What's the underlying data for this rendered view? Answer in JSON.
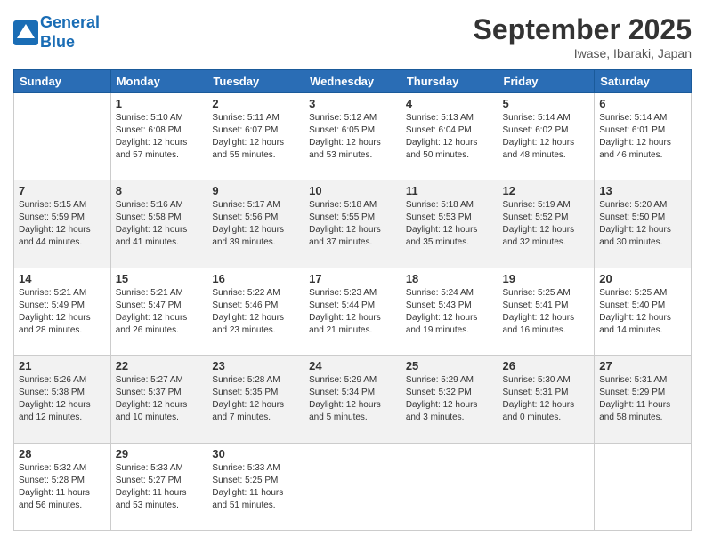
{
  "header": {
    "logo_line1": "General",
    "logo_line2": "Blue",
    "month": "September 2025",
    "location": "Iwase, Ibaraki, Japan"
  },
  "days_of_week": [
    "Sunday",
    "Monday",
    "Tuesday",
    "Wednesday",
    "Thursday",
    "Friday",
    "Saturday"
  ],
  "weeks": [
    [
      {
        "day": "",
        "info": ""
      },
      {
        "day": "1",
        "info": "Sunrise: 5:10 AM\nSunset: 6:08 PM\nDaylight: 12 hours\nand 57 minutes."
      },
      {
        "day": "2",
        "info": "Sunrise: 5:11 AM\nSunset: 6:07 PM\nDaylight: 12 hours\nand 55 minutes."
      },
      {
        "day": "3",
        "info": "Sunrise: 5:12 AM\nSunset: 6:05 PM\nDaylight: 12 hours\nand 53 minutes."
      },
      {
        "day": "4",
        "info": "Sunrise: 5:13 AM\nSunset: 6:04 PM\nDaylight: 12 hours\nand 50 minutes."
      },
      {
        "day": "5",
        "info": "Sunrise: 5:14 AM\nSunset: 6:02 PM\nDaylight: 12 hours\nand 48 minutes."
      },
      {
        "day": "6",
        "info": "Sunrise: 5:14 AM\nSunset: 6:01 PM\nDaylight: 12 hours\nand 46 minutes."
      }
    ],
    [
      {
        "day": "7",
        "info": "Sunrise: 5:15 AM\nSunset: 5:59 PM\nDaylight: 12 hours\nand 44 minutes."
      },
      {
        "day": "8",
        "info": "Sunrise: 5:16 AM\nSunset: 5:58 PM\nDaylight: 12 hours\nand 41 minutes."
      },
      {
        "day": "9",
        "info": "Sunrise: 5:17 AM\nSunset: 5:56 PM\nDaylight: 12 hours\nand 39 minutes."
      },
      {
        "day": "10",
        "info": "Sunrise: 5:18 AM\nSunset: 5:55 PM\nDaylight: 12 hours\nand 37 minutes."
      },
      {
        "day": "11",
        "info": "Sunrise: 5:18 AM\nSunset: 5:53 PM\nDaylight: 12 hours\nand 35 minutes."
      },
      {
        "day": "12",
        "info": "Sunrise: 5:19 AM\nSunset: 5:52 PM\nDaylight: 12 hours\nand 32 minutes."
      },
      {
        "day": "13",
        "info": "Sunrise: 5:20 AM\nSunset: 5:50 PM\nDaylight: 12 hours\nand 30 minutes."
      }
    ],
    [
      {
        "day": "14",
        "info": "Sunrise: 5:21 AM\nSunset: 5:49 PM\nDaylight: 12 hours\nand 28 minutes."
      },
      {
        "day": "15",
        "info": "Sunrise: 5:21 AM\nSunset: 5:47 PM\nDaylight: 12 hours\nand 26 minutes."
      },
      {
        "day": "16",
        "info": "Sunrise: 5:22 AM\nSunset: 5:46 PM\nDaylight: 12 hours\nand 23 minutes."
      },
      {
        "day": "17",
        "info": "Sunrise: 5:23 AM\nSunset: 5:44 PM\nDaylight: 12 hours\nand 21 minutes."
      },
      {
        "day": "18",
        "info": "Sunrise: 5:24 AM\nSunset: 5:43 PM\nDaylight: 12 hours\nand 19 minutes."
      },
      {
        "day": "19",
        "info": "Sunrise: 5:25 AM\nSunset: 5:41 PM\nDaylight: 12 hours\nand 16 minutes."
      },
      {
        "day": "20",
        "info": "Sunrise: 5:25 AM\nSunset: 5:40 PM\nDaylight: 12 hours\nand 14 minutes."
      }
    ],
    [
      {
        "day": "21",
        "info": "Sunrise: 5:26 AM\nSunset: 5:38 PM\nDaylight: 12 hours\nand 12 minutes."
      },
      {
        "day": "22",
        "info": "Sunrise: 5:27 AM\nSunset: 5:37 PM\nDaylight: 12 hours\nand 10 minutes."
      },
      {
        "day": "23",
        "info": "Sunrise: 5:28 AM\nSunset: 5:35 PM\nDaylight: 12 hours\nand 7 minutes."
      },
      {
        "day": "24",
        "info": "Sunrise: 5:29 AM\nSunset: 5:34 PM\nDaylight: 12 hours\nand 5 minutes."
      },
      {
        "day": "25",
        "info": "Sunrise: 5:29 AM\nSunset: 5:32 PM\nDaylight: 12 hours\nand 3 minutes."
      },
      {
        "day": "26",
        "info": "Sunrise: 5:30 AM\nSunset: 5:31 PM\nDaylight: 12 hours\nand 0 minutes."
      },
      {
        "day": "27",
        "info": "Sunrise: 5:31 AM\nSunset: 5:29 PM\nDaylight: 11 hours\nand 58 minutes."
      }
    ],
    [
      {
        "day": "28",
        "info": "Sunrise: 5:32 AM\nSunset: 5:28 PM\nDaylight: 11 hours\nand 56 minutes."
      },
      {
        "day": "29",
        "info": "Sunrise: 5:33 AM\nSunset: 5:27 PM\nDaylight: 11 hours\nand 53 minutes."
      },
      {
        "day": "30",
        "info": "Sunrise: 5:33 AM\nSunset: 5:25 PM\nDaylight: 11 hours\nand 51 minutes."
      },
      {
        "day": "",
        "info": ""
      },
      {
        "day": "",
        "info": ""
      },
      {
        "day": "",
        "info": ""
      },
      {
        "day": "",
        "info": ""
      }
    ]
  ]
}
